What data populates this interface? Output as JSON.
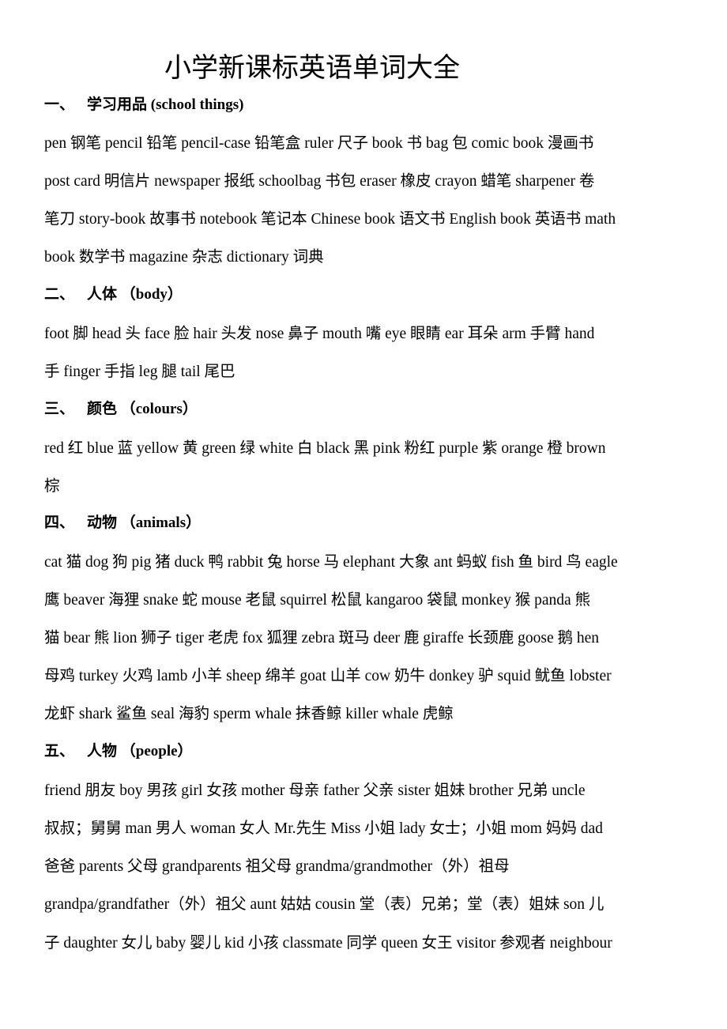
{
  "document": {
    "title": "小学新课标英语单词大全",
    "sections": [
      {
        "number": "一、",
        "heading": "学习用品  (school things)",
        "lines": [
          "pen 钢笔  pencil 铅笔  pencil-case 铅笔盒  ruler 尺子  book 书  bag 包  comic book 漫画书",
          "post card 明信片  newspaper 报纸  schoolbag 书包  eraser 橡皮  crayon 蜡笔  sharpener 卷",
          "笔刀  story-book 故事书  notebook 笔记本  Chinese book 语文书  English book 英语书  math",
          "book 数学书  magazine 杂志  dictionary 词典"
        ]
      },
      {
        "number": "二、",
        "heading": "人体 （body）",
        "lines": [
          "foot 脚  head 头  face 脸  hair 头发  nose 鼻子  mouth 嘴  eye 眼睛  ear 耳朵  arm 手臂  hand",
          "手  finger 手指  leg 腿  tail 尾巴"
        ]
      },
      {
        "number": "三、",
        "heading": "颜色 （colours）",
        "lines": [
          "red 红  blue 蓝  yellow 黄  green 绿  white 白  black 黑  pink 粉红  purple 紫  orange 橙  brown",
          "棕"
        ]
      },
      {
        "number": "四、",
        "heading": "动物 （animals）",
        "lines": [
          "cat 猫  dog 狗  pig 猪  duck 鸭  rabbit 兔  horse 马  elephant 大象  ant 蚂蚁  fish 鱼  bird 鸟  eagle",
          "鹰  beaver 海狸  snake 蛇  mouse 老鼠  squirrel 松鼠  kangaroo 袋鼠  monkey 猴  panda 熊",
          "猫  bear 熊  lion 狮子  tiger 老虎  fox 狐狸  zebra 斑马  deer 鹿  giraffe 长颈鹿  goose 鹅  hen",
          "母鸡  turkey 火鸡  lamb 小羊  sheep 绵羊  goat 山羊  cow 奶牛  donkey 驴  squid 鱿鱼  lobster",
          "龙虾  shark 鲨鱼  seal 海豹  sperm whale 抹香鲸  killer whale 虎鲸"
        ]
      },
      {
        "number": "五、",
        "heading": "人物 （people）",
        "lines": [
          "friend 朋友  boy 男孩  girl 女孩  mother 母亲  father 父亲  sister 姐妹  brother 兄弟  uncle",
          "叔叔；舅舅  man 男人  woman 女人  Mr.先生  Miss 小姐  lady 女士；小姐  mom 妈妈  dad",
          "爸爸  parents 父母  grandparents 祖父母  grandma/grandmother（外）祖母",
          "grandpa/grandfather（外）祖父  aunt 姑姑  cousin 堂（表）兄弟；堂（表）姐妹  son 儿",
          "子  daughter 女儿  baby 婴儿  kid 小孩  classmate 同学  queen 女王  visitor 参观者  neighbour"
        ]
      }
    ]
  }
}
